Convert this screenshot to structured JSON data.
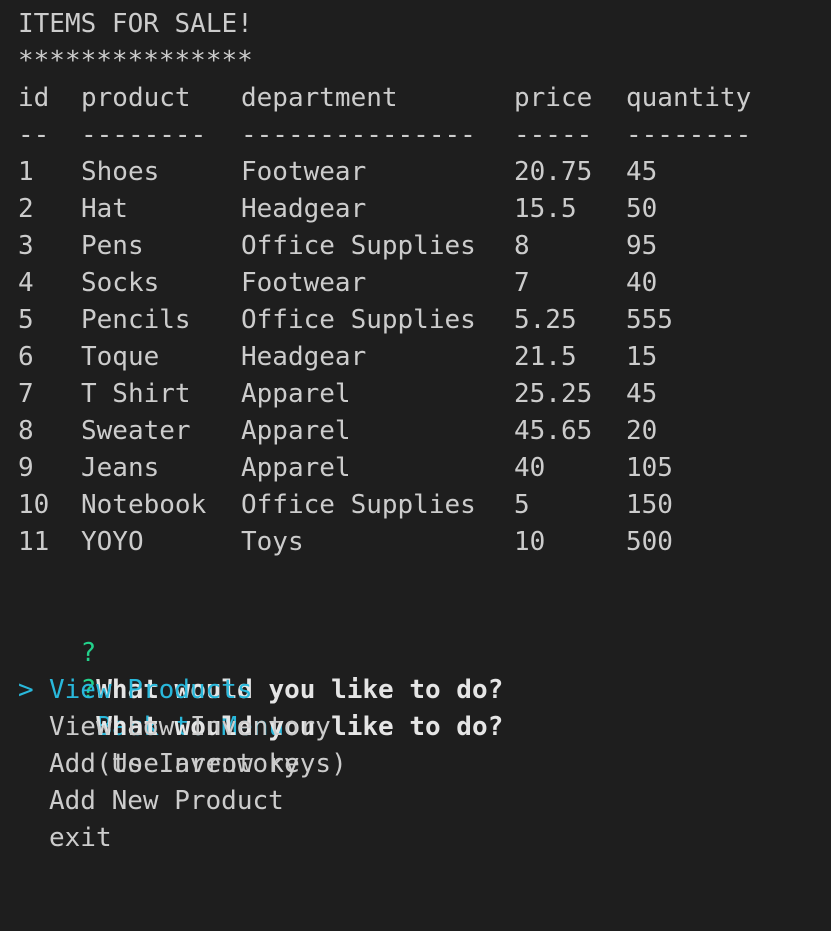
{
  "banner": {
    "title": "ITEMS FOR SALE!",
    "stars": "***************"
  },
  "table": {
    "headers": [
      "id",
      "product",
      "department",
      "price",
      "quantity"
    ],
    "separators": [
      "--",
      "--------",
      "---------------",
      "-----",
      "--------"
    ],
    "rows": [
      [
        "1",
        "Shoes",
        "Footwear",
        "20.75",
        "45"
      ],
      [
        "2",
        "Hat",
        "Headgear",
        "15.5",
        "50"
      ],
      [
        "3",
        "Pens",
        "Office Supplies",
        "8",
        "95"
      ],
      [
        "4",
        "Socks",
        "Footwear",
        "7",
        "40"
      ],
      [
        "5",
        "Pencils",
        "Office Supplies",
        "5.25",
        "555"
      ],
      [
        "6",
        "Toque",
        "Headgear",
        "21.5",
        "15"
      ],
      [
        "7",
        "T Shirt",
        "Apparel",
        "25.25",
        "45"
      ],
      [
        "8",
        "Sweater",
        "Apparel",
        "45.65",
        "20"
      ],
      [
        "9",
        "Jeans",
        "Apparel",
        "40",
        "105"
      ],
      [
        "10",
        "Notebook",
        "Office Supplies",
        "5",
        "150"
      ],
      [
        "11",
        "YOYO",
        "Toys",
        "10",
        "500"
      ]
    ]
  },
  "prompts": {
    "mark": "?",
    "first": {
      "question": "What would you like to do?",
      "answer": "Back to Menu"
    },
    "second": {
      "question": "What would you like to do?",
      "hint": "(Use arrow keys)"
    }
  },
  "menu": {
    "pointer": ">",
    "choices": [
      "View Products",
      "View Low Inventory",
      "Add to Inventory",
      "Add New Product",
      "exit"
    ],
    "selected_index": 0
  },
  "colors": {
    "background": "#1e1e1e",
    "text": "#cccccc",
    "question_mark": "#23d18b",
    "highlight": "#29b8db"
  }
}
